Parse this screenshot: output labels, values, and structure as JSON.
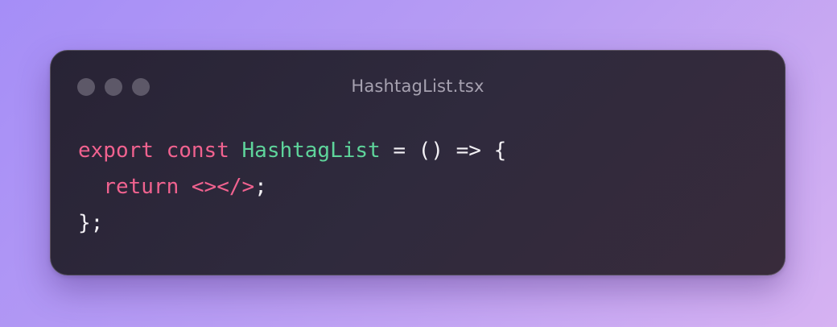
{
  "window": {
    "title": "HashtagList.tsx",
    "controls": [
      "close",
      "minimize",
      "maximize"
    ]
  },
  "code": {
    "lines": [
      {
        "tokens": [
          {
            "text": "export",
            "kind": "keyword"
          },
          {
            "text": " ",
            "kind": "plain"
          },
          {
            "text": "const",
            "kind": "keyword"
          },
          {
            "text": " ",
            "kind": "plain"
          },
          {
            "text": "HashtagList",
            "kind": "function"
          },
          {
            "text": " = () => {",
            "kind": "plain"
          }
        ]
      },
      {
        "tokens": [
          {
            "text": "  ",
            "kind": "plain"
          },
          {
            "text": "return",
            "kind": "keyword"
          },
          {
            "text": " ",
            "kind": "plain"
          },
          {
            "text": "<></>",
            "kind": "tag"
          },
          {
            "text": ";",
            "kind": "plain"
          }
        ]
      },
      {
        "tokens": [
          {
            "text": "};",
            "kind": "plain"
          }
        ]
      }
    ]
  },
  "colors": {
    "background_start": "#a58ef7",
    "background_end": "#d6b2f2",
    "window_bg": "#2b2638",
    "keyword": "#f0628f",
    "function": "#5ed49b",
    "plain": "#f3f1f5",
    "title": "#a6a1b0",
    "window_dot": "#5d5868"
  }
}
